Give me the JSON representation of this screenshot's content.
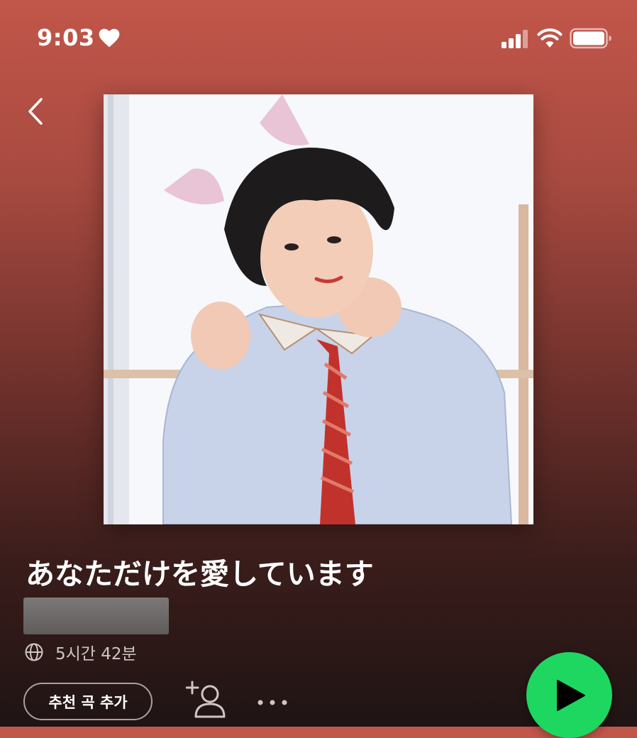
{
  "status_bar": {
    "time": "9:03",
    "icons": [
      "heart-icon",
      "cellular-signal-icon",
      "wifi-icon",
      "battery-icon"
    ]
  },
  "header": {
    "back_icon": "chevron-left-icon"
  },
  "playlist": {
    "title": "あなただけを愛しています",
    "duration": "5시간 42분",
    "visibility_icon": "globe-icon"
  },
  "actions": {
    "recommend_label": "추천 곡 추가",
    "add_collaborator_icon": "add-user-icon",
    "more_icon": "more-dots-icon",
    "play_icon": "play-icon"
  },
  "colors": {
    "play_button": "#1ed760",
    "background_top": "#c2564a",
    "background_bottom": "#1f1414"
  }
}
